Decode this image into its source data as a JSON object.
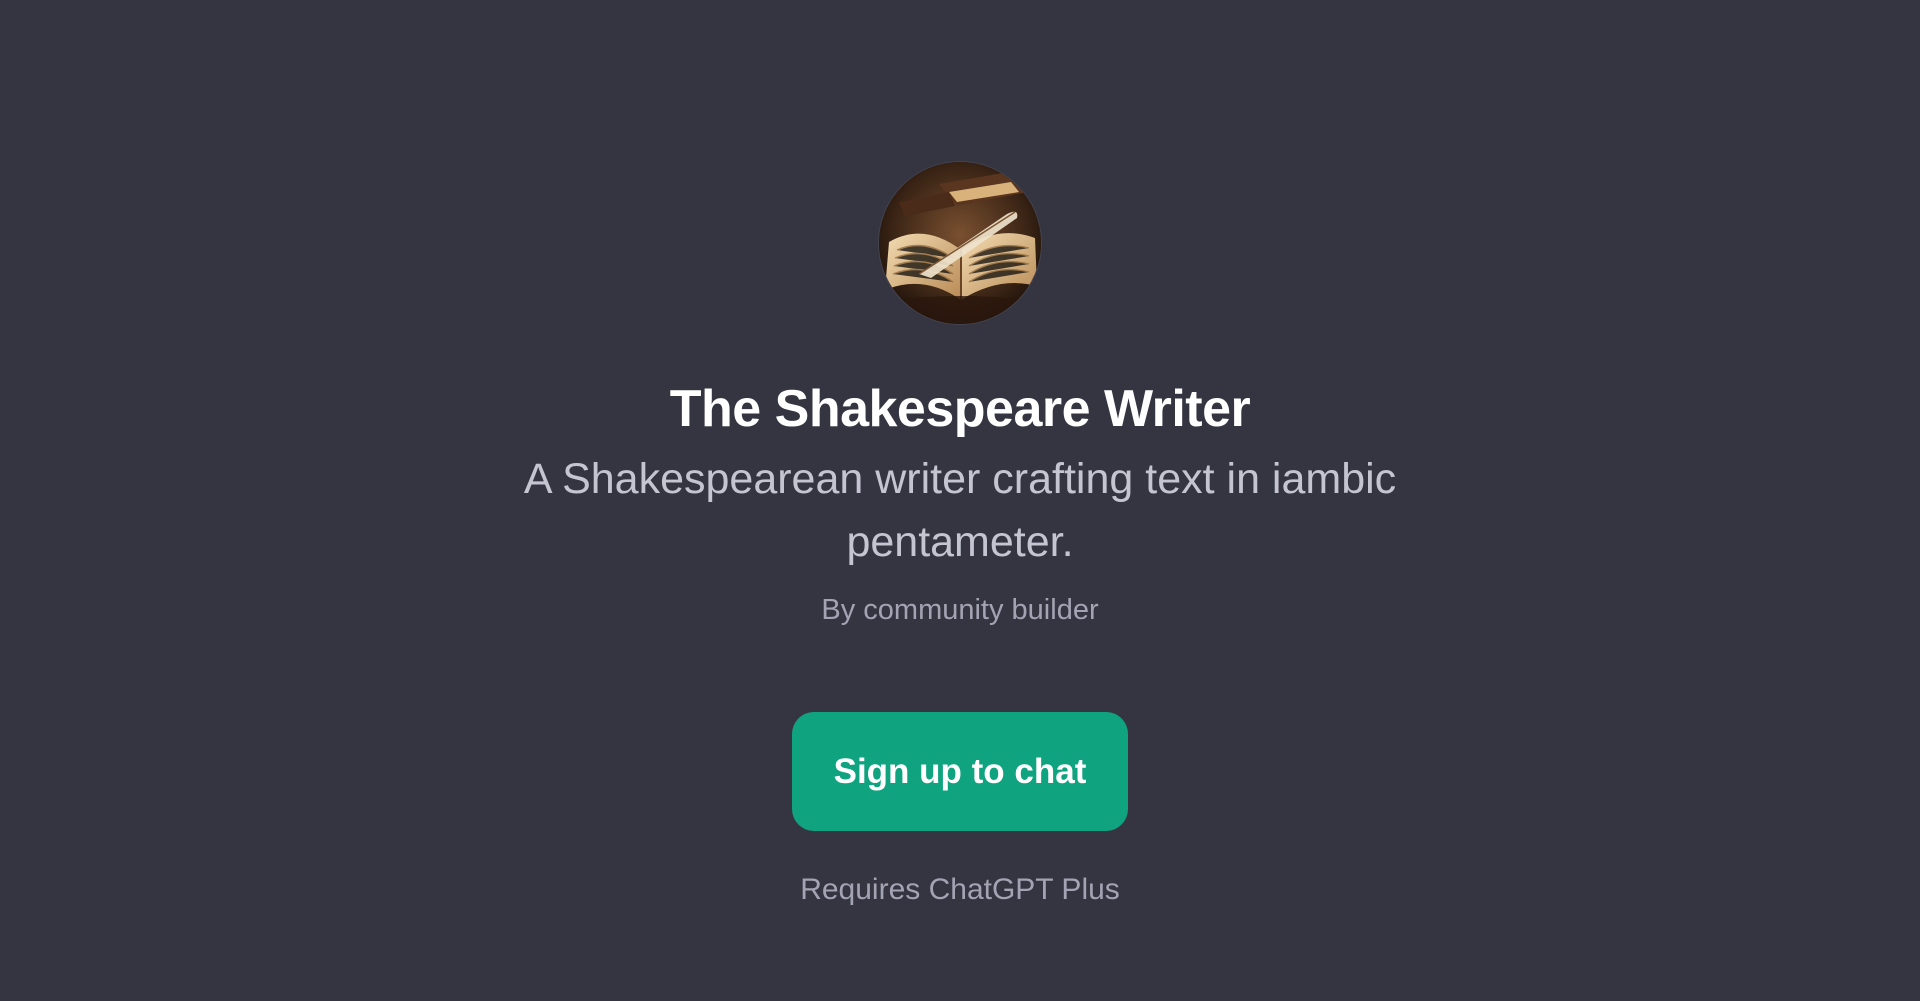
{
  "gpt": {
    "title": "The Shakespeare Writer",
    "description": "A Shakespearean writer crafting text in iambic pentameter.",
    "author": "By community builder",
    "avatar_icon": "open-book-quill-icon"
  },
  "actions": {
    "signup_label": "Sign up to chat"
  },
  "footer": {
    "requirement": "Requires ChatGPT Plus"
  },
  "colors": {
    "background": "#343541",
    "accent": "#10a37f",
    "title": "#ffffff",
    "description": "#c5c5d2",
    "muted": "#a3a3b3"
  }
}
